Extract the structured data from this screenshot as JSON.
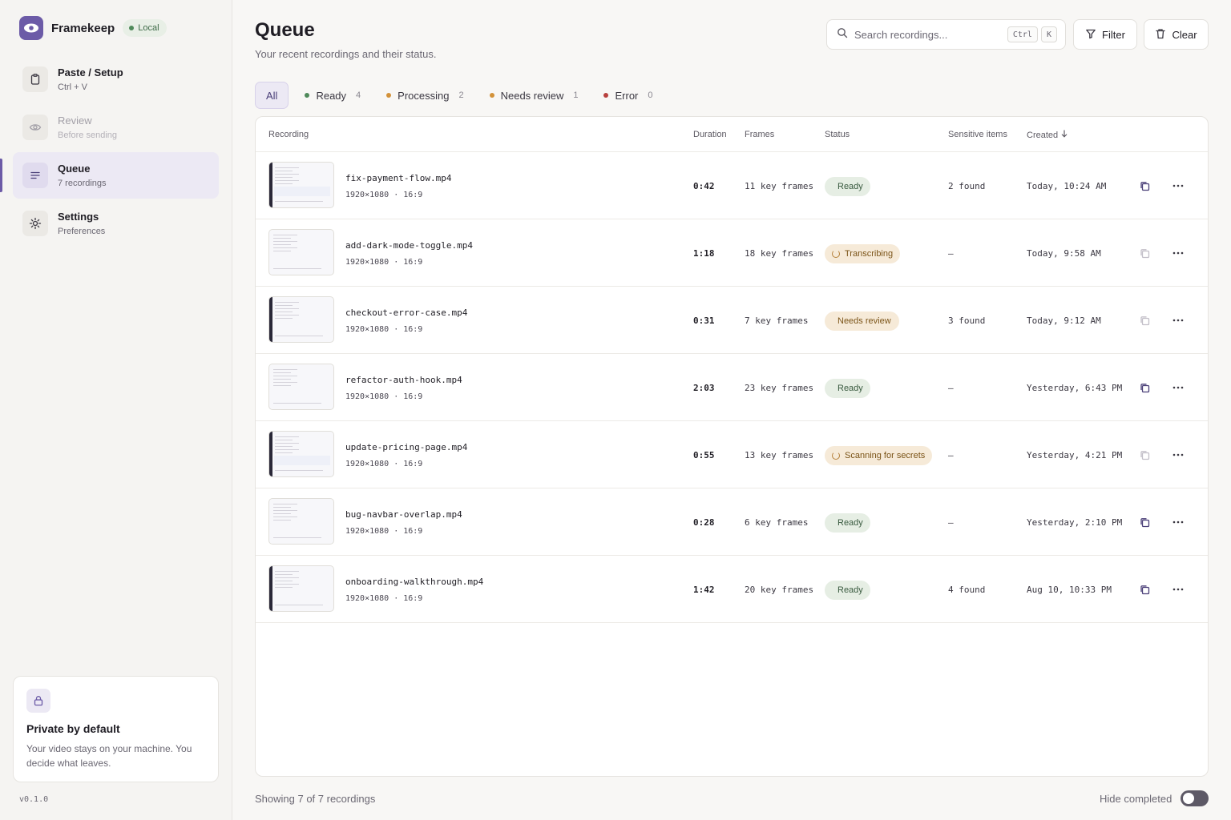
{
  "app": {
    "name": "Framekeep",
    "badge": "Local",
    "version": "v0.1.0"
  },
  "colors": {
    "accent": "#6c5ba7",
    "ready": "#3d6a46",
    "processing": "#d3923a",
    "review": "#d3923a",
    "error": "#b8413e"
  },
  "sidebar": {
    "items": [
      {
        "label": "Paste / Setup",
        "sub": "Ctrl + V",
        "icon": "clipboard-icon"
      },
      {
        "label": "Review",
        "sub": "Before sending",
        "icon": "eye-icon"
      },
      {
        "label": "Queue",
        "sub": "7 recordings",
        "icon": "list-icon"
      },
      {
        "label": "Settings",
        "sub": "Preferences",
        "icon": "gear-icon"
      }
    ],
    "active": "Queue"
  },
  "private_card": {
    "title": "Private by default",
    "text": "Your video stays on your machine. You decide what leaves."
  },
  "header": {
    "title": "Queue",
    "subtitle": "Your recent recordings and their status.",
    "search_placeholder": "Search recordings...",
    "shortcut": [
      "Ctrl",
      "K"
    ],
    "filter_label": "Filter",
    "clear_label": "Clear"
  },
  "tabs": [
    {
      "label": "All",
      "count": ""
    },
    {
      "label": "Ready",
      "count": "4"
    },
    {
      "label": "Processing",
      "count": "2"
    },
    {
      "label": "Needs review",
      "count": "1"
    },
    {
      "label": "Error",
      "count": "0"
    }
  ],
  "table": {
    "columns": [
      "Recording",
      "Duration",
      "Frames",
      "Status",
      "Sensitive items",
      "Created"
    ],
    "sort_column": "Created",
    "rows": [
      {
        "name": "fix-payment-flow.mp4",
        "meta": "1920×1080 · 16:9",
        "duration": "0:42",
        "frames": "11 key frames",
        "status": "Ready",
        "status_kind": "ready",
        "sensitive": "2 found",
        "created": "Today, 10:24 AM"
      },
      {
        "name": "add-dark-mode-toggle.mp4",
        "meta": "1920×1080 · 16:9",
        "duration": "1:18",
        "frames": "18 key frames",
        "status": "Transcribing",
        "status_kind": "processing",
        "sensitive": "—",
        "created": "Today, 9:58 AM"
      },
      {
        "name": "checkout-error-case.mp4",
        "meta": "1920×1080 · 16:9",
        "duration": "0:31",
        "frames": "7 key frames",
        "status": "Needs review",
        "status_kind": "review",
        "sensitive": "3 found",
        "created": "Today, 9:12 AM"
      },
      {
        "name": "refactor-auth-hook.mp4",
        "meta": "1920×1080 · 16:9",
        "duration": "2:03",
        "frames": "23 key frames",
        "status": "Ready",
        "status_kind": "ready",
        "sensitive": "—",
        "created": "Yesterday, 6:43 PM"
      },
      {
        "name": "update-pricing-page.mp4",
        "meta": "1920×1080 · 16:9",
        "duration": "0:55",
        "frames": "13 key frames",
        "status": "Scanning for secrets",
        "status_kind": "processing",
        "sensitive": "—",
        "created": "Yesterday, 4:21 PM"
      },
      {
        "name": "bug-navbar-overlap.mp4",
        "meta": "1920×1080 · 16:9",
        "duration": "0:28",
        "frames": "6 key frames",
        "status": "Ready",
        "status_kind": "ready",
        "sensitive": "—",
        "created": "Yesterday, 2:10 PM"
      },
      {
        "name": "onboarding-walkthrough.mp4",
        "meta": "1920×1080 · 16:9",
        "duration": "1:42",
        "frames": "20 key frames",
        "status": "Ready",
        "status_kind": "ready",
        "sensitive": "4 found",
        "created": "Aug 10, 10:33 PM"
      }
    ]
  },
  "footer": {
    "showing": "Showing 7 of 7 recordings",
    "hide_completed_label": "Hide completed",
    "hide_completed": false
  }
}
